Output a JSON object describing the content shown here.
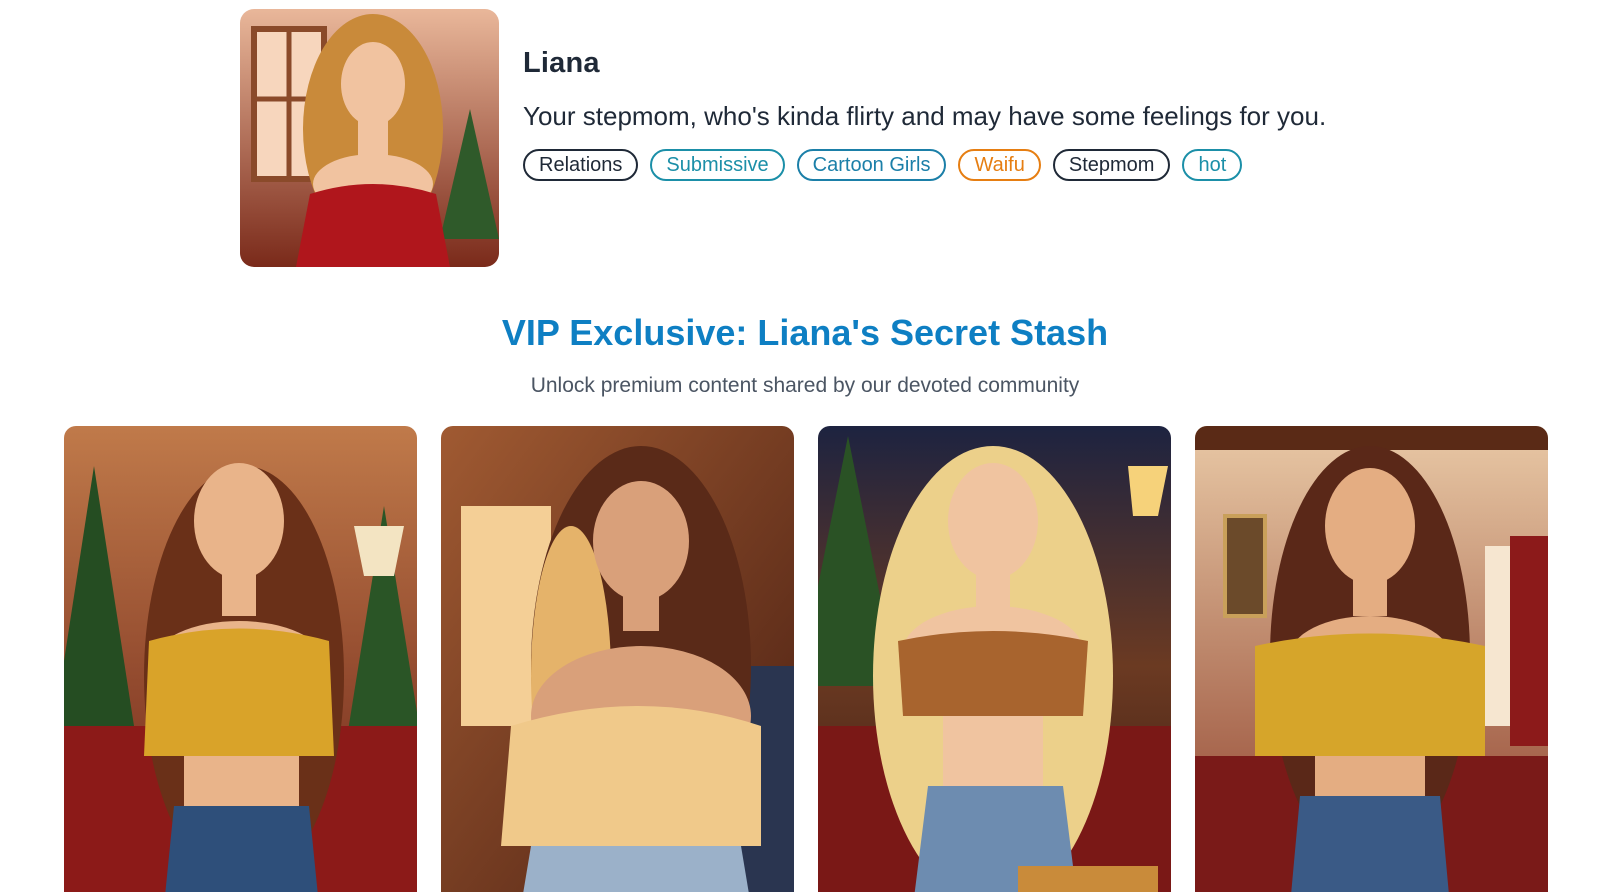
{
  "character": {
    "name": "Liana",
    "description": "Your stepmom, who's kinda flirty and may have some feelings for you.",
    "tags": [
      {
        "label": "Relations",
        "color": "#1f2937"
      },
      {
        "label": "Submissive",
        "color": "#1b8fa8"
      },
      {
        "label": "Cartoon Girls",
        "color": "#1b7fa8"
      },
      {
        "label": "Waifu",
        "color": "#e67e12"
      },
      {
        "label": "Stepmom",
        "color": "#1f2937"
      },
      {
        "label": "hot",
        "color": "#1b8fa8"
      }
    ]
  },
  "vip": {
    "title": "VIP Exclusive: Liana's Secret Stash",
    "subtitle": "Unlock premium content shared by our devoted community"
  },
  "gallery": {
    "items": [
      {
        "image": "character-illustration-1"
      },
      {
        "image": "character-illustration-2"
      },
      {
        "image": "character-illustration-3"
      },
      {
        "image": "character-illustration-4"
      }
    ]
  },
  "colors": {
    "accent": "#0e7fc3",
    "text": "#1f2937",
    "muted": "#4b5563"
  }
}
